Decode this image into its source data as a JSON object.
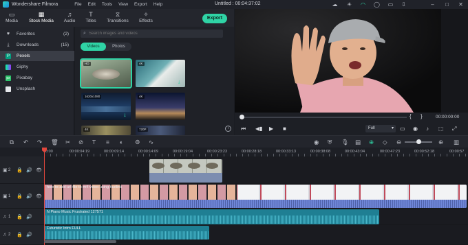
{
  "app": {
    "name": "Wondershare Filmora",
    "project_title": "Untitled : 00:04:37:02"
  },
  "menu": [
    "File",
    "Edit",
    "Tools",
    "View",
    "Export",
    "Help"
  ],
  "toolbar": {
    "tabs": [
      {
        "label": "Media",
        "icon": "folder-icon"
      },
      {
        "label": "Stock Media",
        "icon": "stock-media-icon"
      },
      {
        "label": "Audio",
        "icon": "music-note-icon"
      },
      {
        "label": "Titles",
        "icon": "titles-icon"
      },
      {
        "label": "Transitions",
        "icon": "transitions-icon"
      },
      {
        "label": "Effects",
        "icon": "effects-icon"
      }
    ],
    "active_tab": "Stock Media",
    "export_label": "Export",
    "accent_color": "#2fd3a5"
  },
  "sidebar": {
    "items": [
      {
        "label": "Favorites",
        "count": "(2)",
        "icon": "heart-icon"
      },
      {
        "label": "Downloads",
        "count": "(15)",
        "icon": "download-icon"
      },
      {
        "label": "Pexels",
        "count": "",
        "icon": "pexels-icon"
      },
      {
        "label": "Giphy",
        "count": "",
        "icon": "giphy-icon"
      },
      {
        "label": "Pixabay",
        "count": "",
        "icon": "pixabay-icon"
      },
      {
        "label": "Unsplash",
        "count": "",
        "icon": "unsplash-icon"
      }
    ],
    "active_item": "Pexels"
  },
  "media": {
    "search_placeholder": "Search images and videos",
    "filters": [
      "Videos",
      "Photos"
    ],
    "active_filter": "Videos",
    "thumbnails": [
      {
        "tag": "HD"
      },
      {
        "tag": "4K"
      },
      {
        "tag": "1620x1080"
      },
      {
        "tag": "4K"
      },
      {
        "tag": "4K"
      },
      {
        "tag": "720P"
      }
    ]
  },
  "preview": {
    "timecode": "00:00:00:00",
    "mark_in": "{",
    "mark_out": "}",
    "quality": "Full"
  },
  "ruler": {
    "labels": [
      "00:00",
      "00:00:04:19",
      "00:00:09:14",
      "00:00:14:09",
      "00:00:19:04",
      "00:00:23:23",
      "00:00:28:18",
      "00:00:33:13",
      "00:00:38:08",
      "00:00:43:04",
      "00:00:47:23",
      "00:00:52:18",
      "00:00:57"
    ]
  },
  "tracks": {
    "video_track_2": "2",
    "video_track_1": "1",
    "audio_track_1": "1",
    "audio_track_2": "2",
    "main_clip_label": "how-to-add-url-file-to-m4-video-using-fastlink",
    "audio_clip_1_label": "N Piano Music Frustrated 127571",
    "audio_clip_2_label": "Futuristic Intro FULL"
  }
}
